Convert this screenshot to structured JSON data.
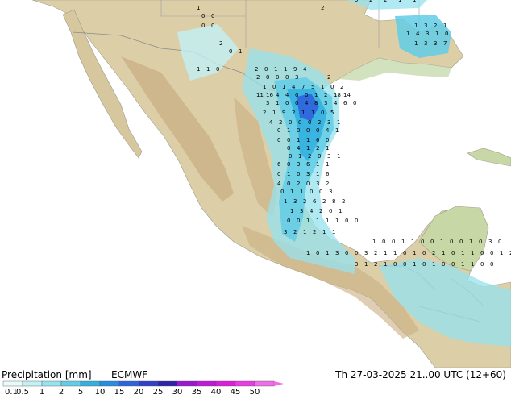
{
  "footer": {
    "title": "Precipitation [mm]",
    "model": "ECMWF",
    "valid_time": "Th 27-03-2025 21..00 UTC (12+60)"
  },
  "legend": {
    "ticks": [
      "0.1",
      "0.5",
      "1",
      "2",
      "5",
      "10",
      "15",
      "20",
      "25",
      "30",
      "35",
      "40",
      "45",
      "50"
    ],
    "colors": [
      "#e8fbfb",
      "#c2f0f5",
      "#96e2ee",
      "#62cde6",
      "#34b0e0",
      "#2a8be4",
      "#2f63dc",
      "#3040c8",
      "#2c23a8",
      "#9918d2",
      "#c01ad8",
      "#dc1ed8",
      "#e83ce2",
      "#f06ce8"
    ]
  },
  "map": {
    "colors": {
      "ocean": "#ffffff",
      "land": "#dccfa8",
      "lowland": "#bfd6a2",
      "highland": "#c9ad82",
      "border": "#8a8a8a"
    },
    "precip_values": [
      "1",
      "2",
      "5",
      "2",
      "2",
      "1",
      "1",
      "0",
      "0",
      "0",
      "0",
      "2",
      "0",
      "1",
      "1",
      "3",
      "2",
      "1",
      "1",
      "4",
      "3",
      "1",
      "0",
      "1",
      "3",
      "3",
      "7",
      "1",
      "1",
      "0",
      "2",
      "0",
      "1",
      "1",
      "9",
      "4",
      "2",
      "0",
      "0",
      "0",
      "3",
      "2",
      "1",
      "0",
      "1",
      "4",
      "7",
      "5",
      "1",
      "0",
      "2",
      "11",
      "16",
      "4",
      "4",
      "0",
      "0",
      "1",
      "2",
      "18",
      "14",
      "3",
      "1",
      "0",
      "0",
      "4",
      "8",
      "3",
      "4",
      "6",
      "0",
      "2",
      "1",
      "9",
      "2",
      "1",
      "1",
      "0",
      "5",
      "4",
      "2",
      "0",
      "0",
      "0",
      "2",
      "3",
      "1",
      "0",
      "1",
      "0",
      "0",
      "0",
      "4",
      "1",
      "0",
      "0",
      "1",
      "1",
      "6",
      "0",
      "0",
      "4",
      "1",
      "2",
      "1",
      "0",
      "1",
      "2",
      "0",
      "3",
      "1",
      "6",
      "0",
      "3",
      "6",
      "1",
      "1",
      "0",
      "1",
      "0",
      "3",
      "1",
      "6",
      "4",
      "0",
      "2",
      "0",
      "3",
      "2",
      "0",
      "1",
      "1",
      "0",
      "0",
      "3",
      "1",
      "3",
      "2",
      "6",
      "2",
      "8",
      "2",
      "1",
      "3",
      "4",
      "2",
      "0",
      "1",
      "0",
      "0",
      "1",
      "1",
      "1",
      "1",
      "0",
      "0",
      "3",
      "2",
      "1",
      "2",
      "1",
      "1",
      "1",
      "0",
      "0",
      "1",
      "1",
      "0",
      "0",
      "1",
      "0",
      "0",
      "1",
      "0",
      "3",
      "0",
      "0",
      "3",
      "2",
      "1",
      "1",
      "0",
      "1",
      "0",
      "2",
      "1",
      "0",
      "1",
      "1",
      "0",
      "0",
      "1",
      "2",
      "0",
      "3",
      "1",
      "0",
      "1",
      "3",
      "1",
      "2",
      "1",
      "0",
      "0",
      "1",
      "0",
      "1",
      "0",
      "0",
      "1",
      "1",
      "0",
      "0"
    ]
  }
}
